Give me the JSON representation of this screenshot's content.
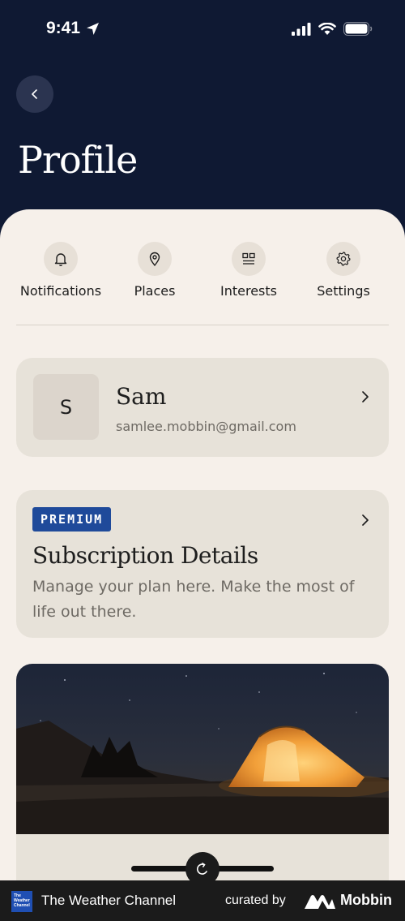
{
  "status_bar": {
    "time": "9:41"
  },
  "header": {
    "title": "Profile"
  },
  "quick_links": [
    {
      "label": "Notifications",
      "icon": "bell-icon"
    },
    {
      "label": "Places",
      "icon": "location-pin-icon"
    },
    {
      "label": "Interests",
      "icon": "grid-icon"
    },
    {
      "label": "Settings",
      "icon": "gear-icon"
    }
  ],
  "profile": {
    "initial": "S",
    "name": "Sam",
    "email": "samlee.mobbin@gmail.com"
  },
  "subscription": {
    "badge": "PREMIUM",
    "title": "Subscription Details",
    "description": "Manage your plan here. Make the most of life out there."
  },
  "footer": {
    "brand": "The Weather Channel",
    "logo_text": "The Weather Channel",
    "curated_by": "curated by",
    "curator": "Mobbin"
  },
  "colors": {
    "header_bg": "#0f1933",
    "sheet_bg": "#f6f0ea",
    "card_bg": "#e7e2d9",
    "badge_bg": "#1f4a9a"
  }
}
